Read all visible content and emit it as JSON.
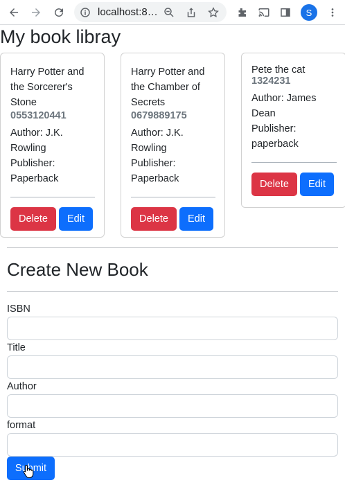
{
  "browser": {
    "url": "localhost:8…",
    "profile_initial": "S",
    "icons": [
      "back-arrow-icon",
      "forward-arrow-icon",
      "reload-icon",
      "info-icon",
      "zoom-icon",
      "share-icon",
      "star-icon",
      "extensions-icon",
      "cast-icon",
      "sidepanel-icon",
      "kebab-menu-icon"
    ]
  },
  "page": {
    "title": "My book libray"
  },
  "books": [
    {
      "title": "Harry Potter and the Sorcerer's Stone",
      "isbn": "0553120441",
      "author_label": "Author: J.K. Rowling",
      "publisher_label": "Publisher: Paperback"
    },
    {
      "title": "Harry Potter and the Chamber of Secrets",
      "isbn": "0679889175",
      "author_label": "Author: J.K. Rowling",
      "publisher_label": "Publisher: Paperback"
    },
    {
      "title": "Pete the cat",
      "isbn": "1324231",
      "author_label": "Author: James Dean",
      "publisher_label": "Publisher: paperback"
    }
  ],
  "card_actions": {
    "delete_label": "Delete",
    "edit_label": "Edit"
  },
  "form": {
    "heading": "Create New Book",
    "fields": [
      {
        "label": "ISBN",
        "value": ""
      },
      {
        "label": "Title",
        "value": ""
      },
      {
        "label": "Author",
        "value": ""
      },
      {
        "label": "format",
        "value": ""
      }
    ],
    "submit_label": "Submit"
  },
  "colors": {
    "danger": "#dc3545",
    "primary": "#0d6efd",
    "muted": "#6c757d"
  }
}
